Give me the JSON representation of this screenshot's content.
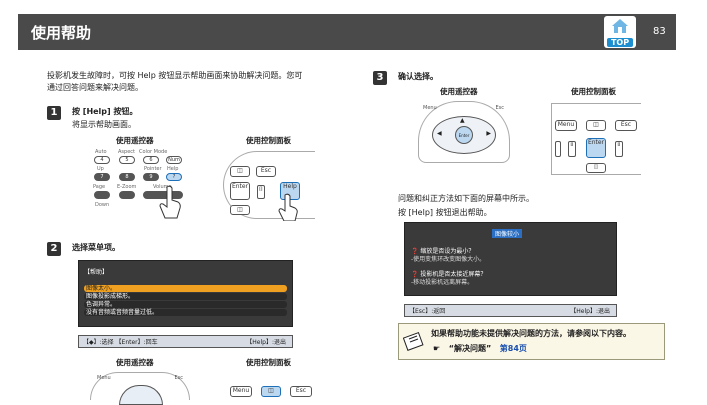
{
  "header": {
    "title": "使用帮助",
    "top_label": "TOP",
    "page_number": "83"
  },
  "intro": {
    "line1": "投影机发生故障时，可按 Help 按钮显示帮助画面来协助解决问题。您可",
    "line2": "通过回答问题来解决问题。"
  },
  "step1": {
    "num": "1",
    "title": "按 [Help] 按钮。",
    "desc": "将显示帮助画面。",
    "cap_remote": "使用遥控器",
    "cap_panel": "使用控制面板",
    "remote_labels": [
      "Auto",
      "Aspect",
      "Color Mode",
      "Up",
      "Pointer",
      "Help",
      "Page",
      "E-Zoom",
      "Volume",
      "Down"
    ],
    "remote_nums": [
      "4",
      "5",
      "6",
      "Num",
      "7",
      "8",
      "9",
      "?"
    ],
    "panel_labels": [
      "Enter",
      "Esc",
      "Help"
    ]
  },
  "step2": {
    "num": "2",
    "title": "选择菜单项。",
    "menu_title": "【帮助】",
    "menu_items": [
      "图像太小。",
      "图像投影成梯形。",
      "色调异常。",
      "没有音频或音频音量过低。"
    ],
    "footer_left": "【◆】:选择 【Enter】:回车",
    "footer_right": "【Help】:退出",
    "cap_remote": "使用遥控器",
    "cap_panel": "使用控制面板",
    "remote_labels": [
      "Menu",
      "Esc"
    ],
    "panel_labels": [
      "Menu",
      "Esc"
    ]
  },
  "step3": {
    "num": "3",
    "title": "确认选择。",
    "cap_remote": "使用遥控器",
    "cap_panel": "使用控制面板",
    "remote_labels": [
      "Menu",
      "Esc",
      "Enter"
    ],
    "panel_labels": [
      "Menu",
      "Esc",
      "Enter"
    ],
    "desc1": "问题和纠正方法如下面的屏幕中所示。",
    "desc2": "按 [Help] 按钮退出帮助。",
    "screen_title": "图像较小",
    "q1": "缩放是否设为最小？",
    "a1": "-使用变焦环改变图像大小。",
    "q2": "投影机是否太接近屏幕？",
    "a2": "-移动投影机远离屏幕。",
    "footer_left": "【Esc】:返回",
    "footer_right": "【Help】:退出"
  },
  "note": {
    "line1": "如果帮助功能未提供解决问题的方法，请参阅以下内容。",
    "arrow": "☛",
    "link_text": "“解决问题”",
    "link_page": "第84页"
  },
  "colors": {
    "header_bg": "#4a4a4a",
    "highlight": "#f0a020",
    "screen_bg": "#3a3a3a",
    "link": "#1a4fb0",
    "top_badge": "#1d8fd1"
  }
}
